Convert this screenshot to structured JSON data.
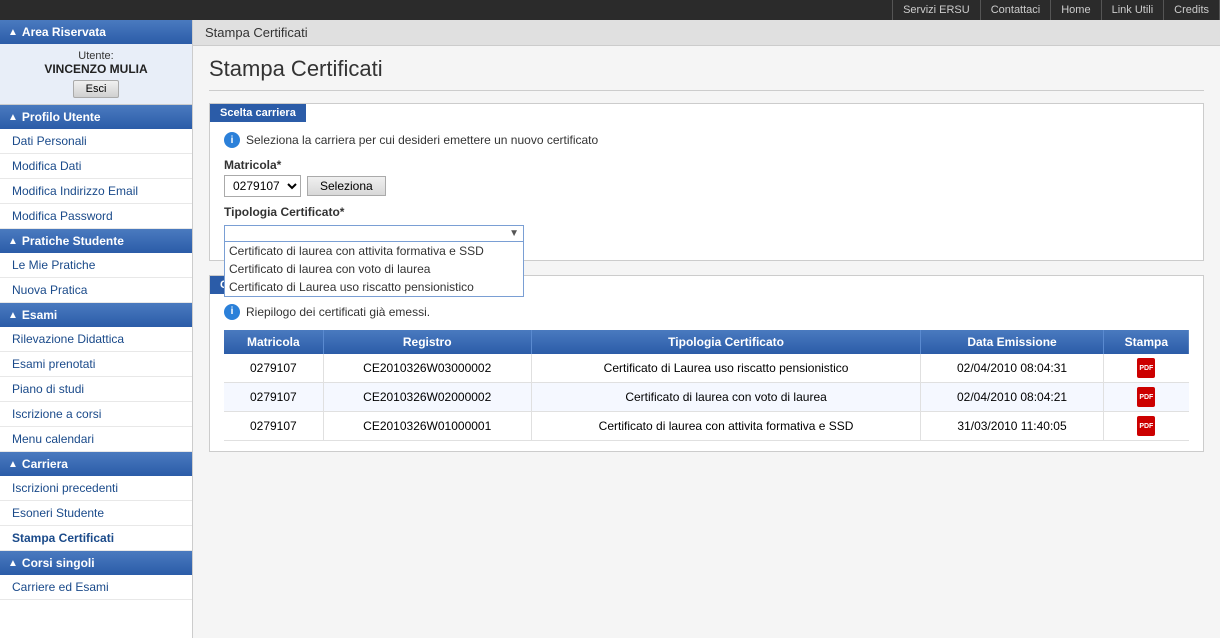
{
  "topnav": {
    "items": [
      {
        "id": "servizi-ersu",
        "label": "Servizi ERSU"
      },
      {
        "id": "contattaci",
        "label": "Contattaci"
      },
      {
        "id": "home",
        "label": "Home"
      },
      {
        "id": "link-utili",
        "label": "Link Utili"
      },
      {
        "id": "credits",
        "label": "Credits"
      }
    ]
  },
  "sidebar": {
    "area_riservata": "Area Riservata",
    "utente_label": "Utente:",
    "username": "VINCENZO MULIA",
    "logout_label": "Esci",
    "profilo_utente": "Profilo Utente",
    "items_profilo": [
      {
        "id": "dati-personali",
        "label": "Dati Personali"
      },
      {
        "id": "modifica-dati",
        "label": "Modifica Dati"
      },
      {
        "id": "modifica-indirizzo-email",
        "label": "Modifica Indirizzo Email"
      },
      {
        "id": "modifica-password",
        "label": "Modifica Password"
      }
    ],
    "pratiche_studente": "Pratiche Studente",
    "items_pratiche": [
      {
        "id": "le-mie-pratiche",
        "label": "Le Mie Pratiche"
      },
      {
        "id": "nuova-pratica",
        "label": "Nuova Pratica"
      }
    ],
    "esami": "Esami",
    "items_esami": [
      {
        "id": "rilevazione-didattica",
        "label": "Rilevazione Didattica"
      },
      {
        "id": "esami-prenotati",
        "label": "Esami prenotati"
      },
      {
        "id": "piano-di-studi",
        "label": "Piano di studi"
      },
      {
        "id": "iscrizione-a-corsi",
        "label": "Iscrizione a corsi"
      },
      {
        "id": "menu-calendari",
        "label": "Menu calendari"
      }
    ],
    "carriera": "Carriera",
    "items_carriera": [
      {
        "id": "iscrizioni-precedenti",
        "label": "Iscrizioni precedenti"
      },
      {
        "id": "esoneri-studente",
        "label": "Esoneri Studente"
      },
      {
        "id": "stampa-certificati",
        "label": "Stampa Certificati",
        "active": true
      }
    ],
    "corsi_singoli": "Corsi singoli",
    "items_corsi": [
      {
        "id": "carriera-ed-esami",
        "label": "Carriere ed Esami"
      }
    ]
  },
  "main": {
    "breadcrumb": "Stampa Certificati",
    "page_title": "Stampa Certificati",
    "scelta_carriera_tab": "Scelta carriera",
    "info_text": "Seleziona la carriera per cui desideri emettere un nuovo certificato",
    "matricola_label": "Matricola*",
    "matricola_value": "0279107",
    "seleziona_label": "Seleziona",
    "tipologia_label": "Tipologia Certificato*",
    "dropdown_options": [
      {
        "id": "opt1",
        "label": "Certificato di laurea con attivita formativa e SSD",
        "selected": false
      },
      {
        "id": "opt2",
        "label": "Certificato di laurea con voto di laurea",
        "selected": false
      },
      {
        "id": "opt3",
        "label": "Certificato di Laurea uso riscatto pensionistico",
        "selected": false
      }
    ],
    "certificati_emessi_tab": "Certificati Emessi",
    "riepilogo_text": "Riepilogo dei certificati già emessi.",
    "table_headers": [
      "Matricola",
      "Registro",
      "Tipologia Certificato",
      "Data Emissione",
      "Stampa"
    ],
    "table_rows": [
      {
        "matricola": "0279107",
        "registro": "CE2010326W03000002",
        "tipologia": "Certificato di Laurea uso riscatto pensionistico",
        "data_emissione": "02/04/2010 08:04:31",
        "stampa": "pdf"
      },
      {
        "matricola": "0279107",
        "registro": "CE2010326W02000002",
        "tipologia": "Certificato di laurea con voto di laurea",
        "data_emissione": "02/04/2010 08:04:21",
        "stampa": "pdf"
      },
      {
        "matricola": "0279107",
        "registro": "CE2010326W01000001",
        "tipologia": "Certificato di laurea con attivita formativa e SSD",
        "data_emissione": "31/03/2010 11:40:05",
        "stampa": "pdf"
      }
    ]
  }
}
